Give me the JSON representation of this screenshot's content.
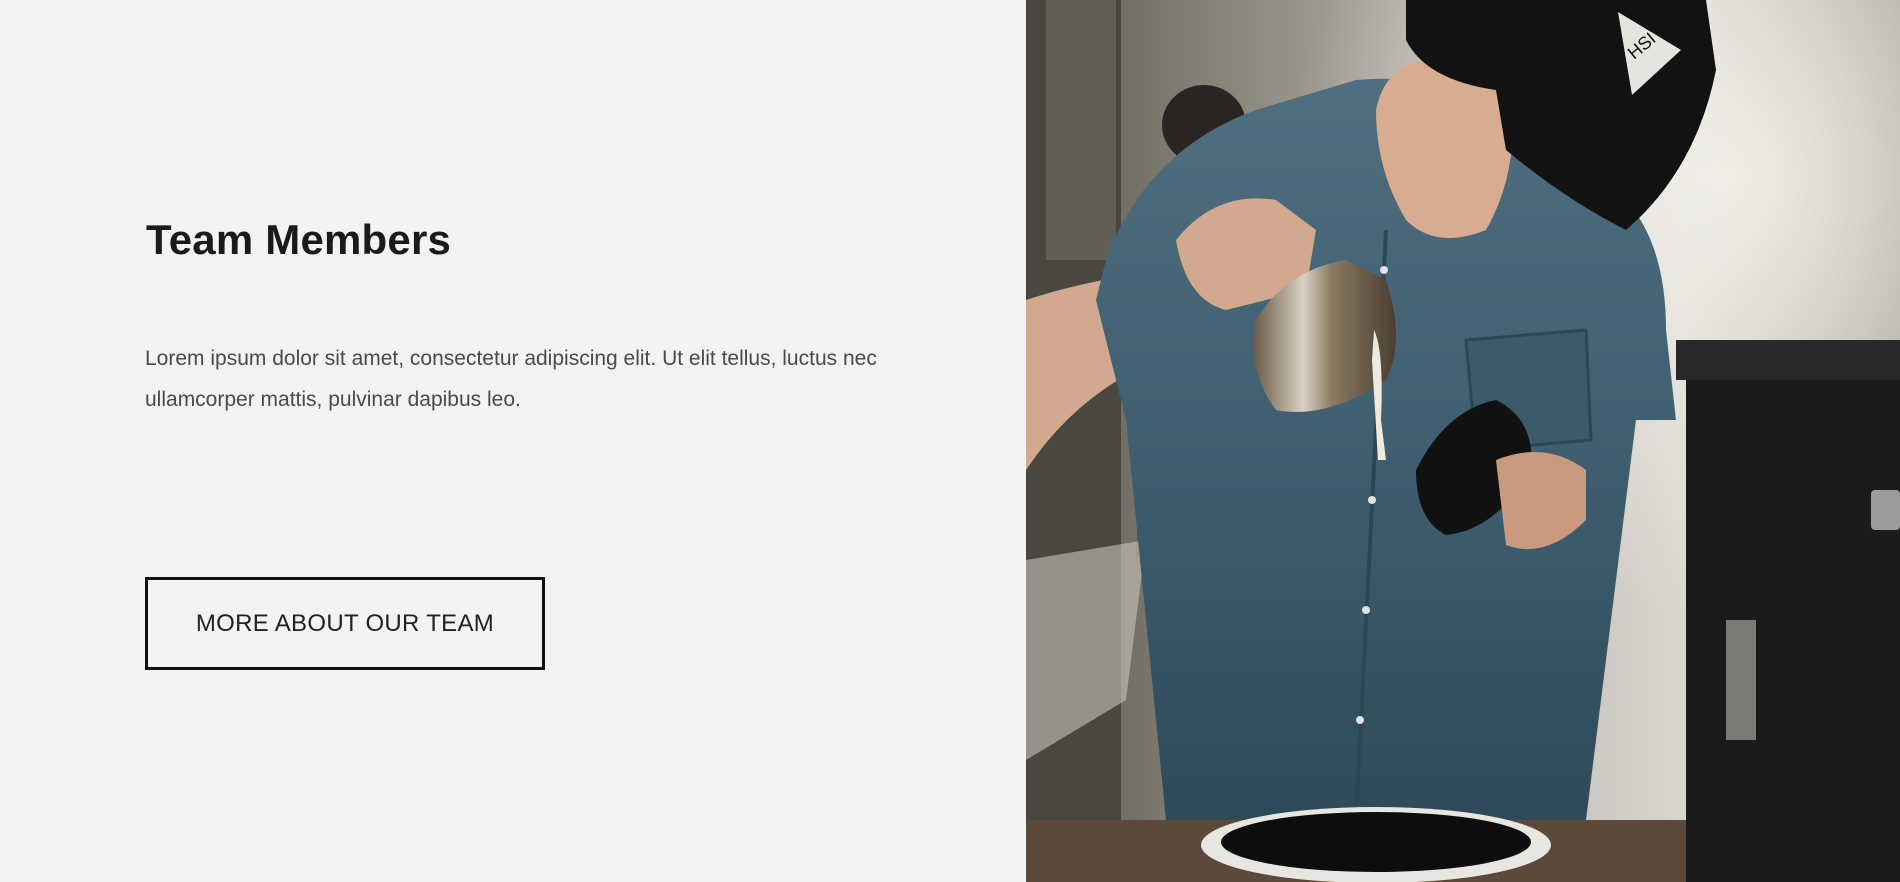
{
  "section": {
    "title": "Team Members",
    "description": "Lorem ipsum dolor sit amet, consectetur adipiscing elit. Ut elit tellus, luctus nec ullamcorper mattis, pulvinar dapibus leo.",
    "button_label": "MORE ABOUT OUR TEAM"
  },
  "colors": {
    "background": "#f3f3f3",
    "heading": "#1a1a1a",
    "body_text": "#4a4a4a",
    "button_border": "#111111"
  }
}
